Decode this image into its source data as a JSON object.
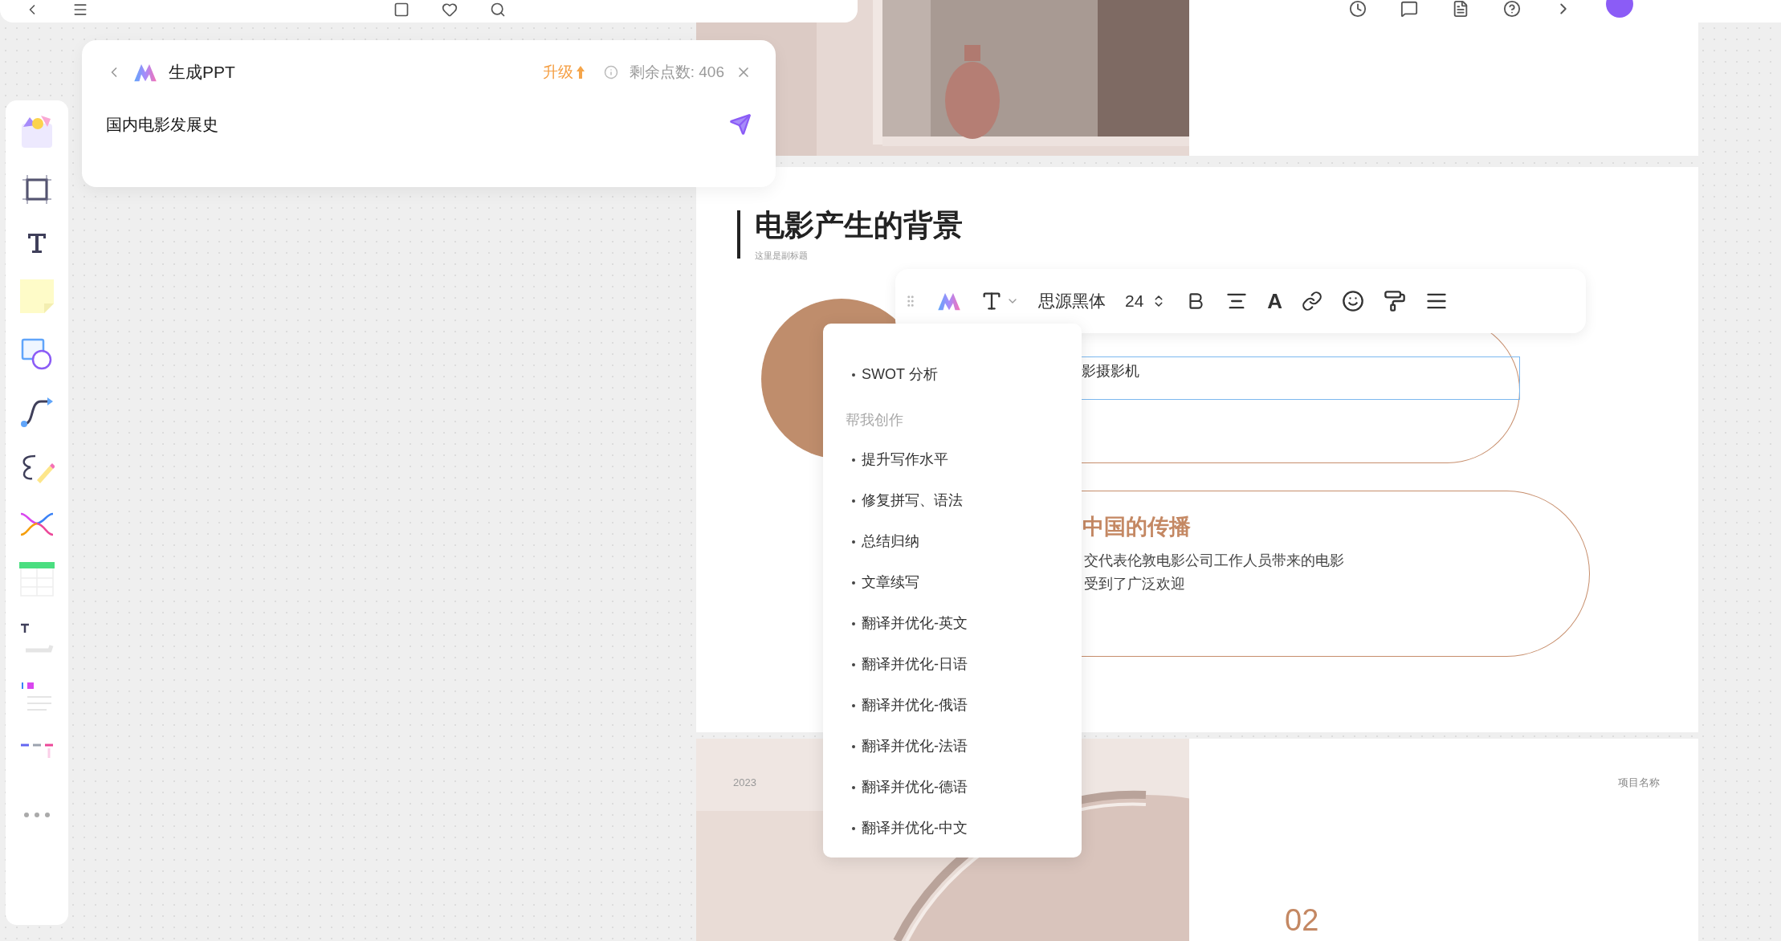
{
  "ppt_panel": {
    "title": "生成PPT",
    "upgrade": "升级",
    "points": "剩余点数: 406",
    "prompt": "国内电影发展史"
  },
  "slide_main": {
    "title": "电影产生的背景",
    "subtitle": "这里是副标题",
    "box_text": "影摄影机",
    "heading": "中国的传播",
    "paragraph": [
      "交代表伦敦电影公司工作人员带来的电影",
      "受到了广泛欢迎"
    ]
  },
  "text_toolbar": {
    "font": "思源黑体",
    "size": "24",
    "color_glyph": "A"
  },
  "menu": {
    "items": [
      {
        "kind": "item",
        "text": "SWOT 分析"
      },
      {
        "kind": "heading",
        "text": "帮我创作"
      },
      {
        "kind": "item",
        "text": "提升写作水平"
      },
      {
        "kind": "item",
        "text": "修复拼写、语法"
      },
      {
        "kind": "item",
        "text": "总结归纳"
      },
      {
        "kind": "item",
        "text": "文章续写"
      },
      {
        "kind": "item",
        "text": "翻译并优化-英文"
      },
      {
        "kind": "item",
        "text": "翻译并优化-日语"
      },
      {
        "kind": "item",
        "text": "翻译并优化-俄语"
      },
      {
        "kind": "item",
        "text": "翻译并优化-法语"
      },
      {
        "kind": "item",
        "text": "翻译并优化-德语"
      },
      {
        "kind": "item",
        "text": "翻译并优化-中文"
      }
    ]
  },
  "slide_bottom": {
    "year": "2023",
    "project": "项目名称",
    "number": "02"
  }
}
